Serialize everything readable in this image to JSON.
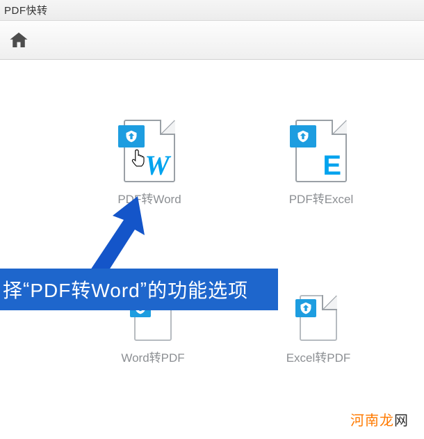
{
  "app": {
    "title": "PDF快转"
  },
  "tiles": {
    "pdf2word": {
      "label": "PDF转Word",
      "glyph": "W",
      "icon": "pdf-icon"
    },
    "pdf2excel": {
      "label": "PDF转Excel",
      "glyph": "E",
      "icon": "pdf-icon"
    },
    "word2pdf": {
      "label": "Word转PDF",
      "icon": "pdf-icon"
    },
    "excel2pdf": {
      "label": "Excel转PDF",
      "icon": "pdf-icon"
    }
  },
  "caption": {
    "prefix": "择",
    "open_quote": "“",
    "highlight": "PDF转Word",
    "close_quote": "”",
    "suffix": "的功能选项"
  },
  "watermark": {
    "brand_a": "河南龙",
    "brand_b": "网"
  },
  "colors": {
    "accent": "#1d9de0",
    "banner": "#1e66cc",
    "wm_a": "#ff7a00",
    "wm_b": "#2e2e2e"
  }
}
